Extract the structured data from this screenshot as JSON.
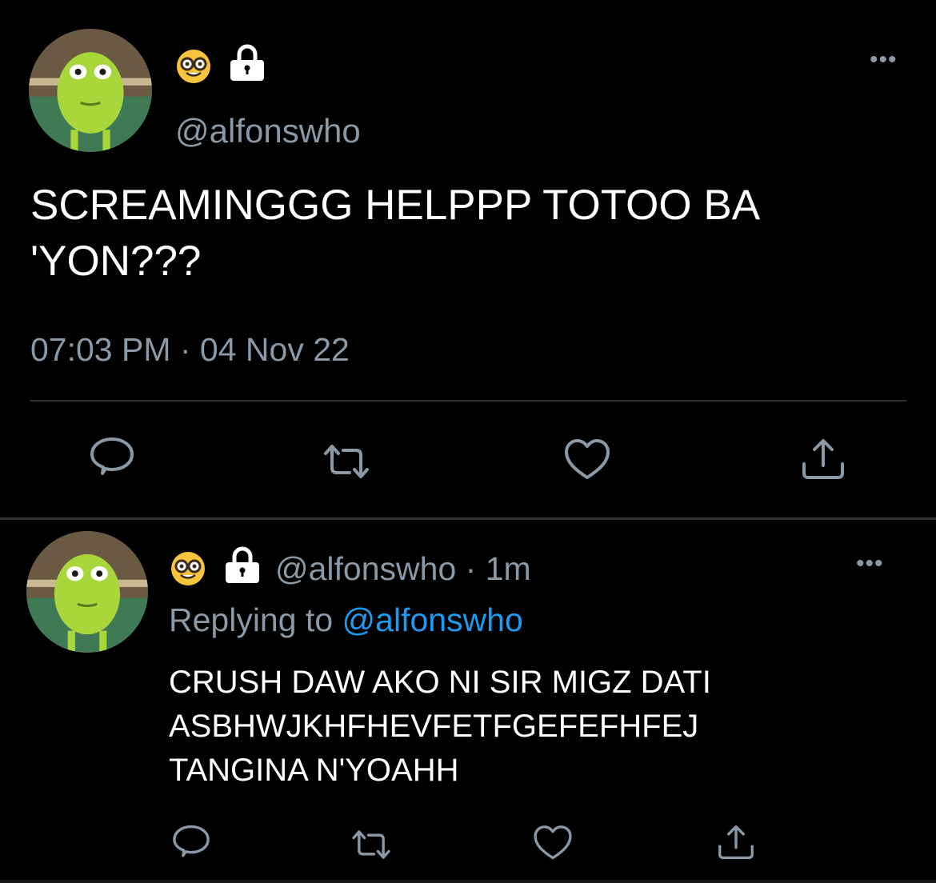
{
  "main_tweet": {
    "handle": "@alfonswho",
    "text_line1": "SCREAMINGGG HELPPP TOTOO BA",
    "text_line2": "'YON???",
    "timestamp": "07:03 PM · 04 Nov 22",
    "badge_emoji": "nerd-face-emoji",
    "lock_icon": "lock-icon",
    "more_label": "•••"
  },
  "reply_tweet": {
    "handle": "@alfonswho",
    "separator": "·",
    "time_ago": "1m",
    "replying_label": "Replying to",
    "replying_handle": "@alfonswho",
    "text_line1": "CRUSH DAW AKO NI SIR MIGZ DATI",
    "text_line2": "ASBHWJKHFHEVFETFGEFEFHFEJ",
    "text_line3": "TANGINA N'YOAHH",
    "more_label": "•••"
  },
  "actions": [
    "reply-icon",
    "retweet-icon",
    "like-icon",
    "share-icon"
  ],
  "colors": {
    "background": "#000000",
    "text": "#ffffff",
    "muted": "#8b98a5",
    "link": "#1d9bf0",
    "divider": "#2f3336"
  }
}
